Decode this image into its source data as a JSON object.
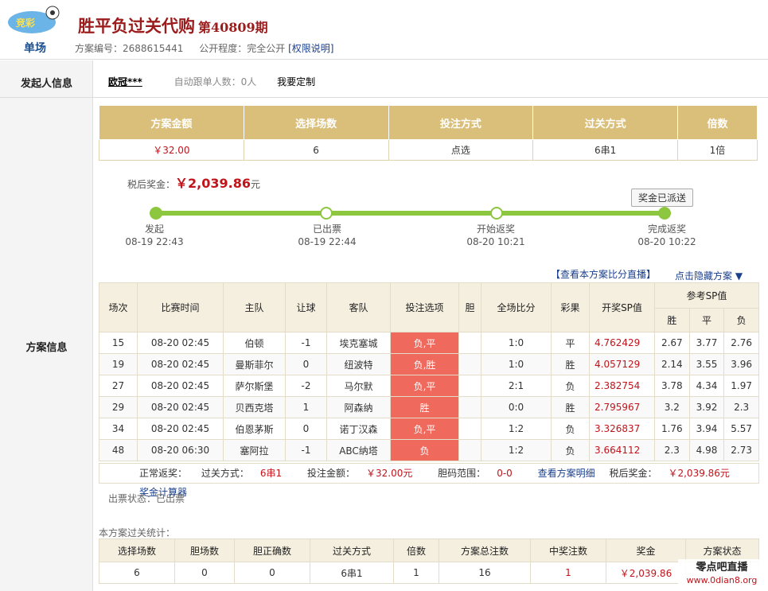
{
  "header": {
    "logo_text": "单场",
    "title": "胜平负过关代购",
    "period": "第40809期",
    "plan_no_label": "方案编号：",
    "plan_no": "2688615441",
    "public_label": "公开程度：",
    "public_value": "完全公开",
    "perm_link": "[权限说明]"
  },
  "left_labels": {
    "initiator": "发起人信息",
    "plan": "方案信息"
  },
  "initiator": {
    "name": "欧冠***",
    "follow": "自动跟单人数：0人",
    "custom": "我要定制"
  },
  "summary": {
    "headers": [
      "方案金额",
      "选择场数",
      "投注方式",
      "过关方式",
      "倍数"
    ],
    "values": [
      "￥32.00",
      "6",
      "点选",
      "6串1",
      "1倍"
    ]
  },
  "prize": {
    "label": "税后奖金：",
    "amount": "￥2,039.86",
    "unit": "元"
  },
  "progress": {
    "paid_button": "奖金已派送",
    "steps": [
      {
        "label": "发起",
        "time": "08-19 22:43"
      },
      {
        "label": "已出票",
        "time": "08-19 22:44"
      },
      {
        "label": "开始返奖",
        "time": "08-20 10:21"
      },
      {
        "label": "完成返奖",
        "time": "08-20 10:22"
      }
    ]
  },
  "links": {
    "live": "【查看本方案比分直播】",
    "hide": "点击隐藏方案 ▼"
  },
  "matches": {
    "headers": [
      "场次",
      "比赛时间",
      "主队",
      "让球",
      "客队",
      "投注选项",
      "胆",
      "全场比分",
      "彩果",
      "开奖SP值",
      "参考SP值"
    ],
    "sp_sub": [
      "胜",
      "平",
      "负"
    ],
    "rows": [
      {
        "no": "15",
        "time": "08-20 02:45",
        "home": "伯顿",
        "hcp": "-1",
        "away": "埃克塞城",
        "pick": "负,平",
        "banker": "",
        "score": "1:0",
        "result": "平",
        "sp": "4.762429",
        "w": "2.67",
        "d": "3.77",
        "l": "2.76"
      },
      {
        "no": "19",
        "time": "08-20 02:45",
        "home": "曼斯菲尔",
        "hcp": "0",
        "away": "纽波特",
        "pick": "负,胜",
        "banker": "",
        "score": "1:0",
        "result": "胜",
        "sp": "4.057129",
        "w": "2.14",
        "d": "3.55",
        "l": "3.96"
      },
      {
        "no": "27",
        "time": "08-20 02:45",
        "home": "萨尔斯堡",
        "hcp": "-2",
        "away": "马尔默",
        "pick": "负,平",
        "banker": "",
        "score": "2:1",
        "result": "负",
        "sp": "2.382754",
        "w": "3.78",
        "d": "4.34",
        "l": "1.97"
      },
      {
        "no": "29",
        "time": "08-20 02:45",
        "home": "贝西克塔",
        "hcp": "1",
        "away": "阿森纳",
        "pick": "胜",
        "banker": "",
        "score": "0:0",
        "result": "胜",
        "sp": "2.795967",
        "w": "3.2",
        "d": "3.92",
        "l": "2.3"
      },
      {
        "no": "34",
        "time": "08-20 02:45",
        "home": "伯恩茅斯",
        "hcp": "0",
        "away": "诺丁汉森",
        "pick": "负,平",
        "banker": "",
        "score": "1:2",
        "result": "负",
        "sp": "3.326837",
        "w": "1.76",
        "d": "3.94",
        "l": "5.57"
      },
      {
        "no": "48",
        "time": "08-20 06:30",
        "home": "塞阿拉",
        "hcp": "-1",
        "away": "ABC纳塔",
        "pick": "负",
        "banker": "",
        "score": "1:2",
        "result": "负",
        "sp": "3.664112",
        "w": "2.3",
        "d": "4.98",
        "l": "2.73"
      }
    ],
    "footer": {
      "return_label": "正常返奖：",
      "pass_label": "过关方式：",
      "pass_value": "6串1",
      "amount_label": "投注金额：",
      "amount_value": "￥32.00元",
      "banker_label": "胆码范围：",
      "banker_value": "0-0",
      "detail_link": "查看方案明细",
      "tax_label": "税后奖金：",
      "tax_value": "￥2,039.86元",
      "calc_link": "奖金计算器"
    }
  },
  "ticket_status": "出票状态：已出票",
  "stats": {
    "title": "本方案过关统计：",
    "headers": [
      "选择场数",
      "胆场数",
      "胆正确数",
      "过关方式",
      "倍数",
      "方案总注数",
      "中奖注数",
      "奖金",
      "方案状态"
    ],
    "values": [
      "6",
      "0",
      "0",
      "6串1",
      "1",
      "16",
      "1",
      "￥2,039.86",
      ""
    ]
  },
  "watermark": {
    "line1": "零点吧直播",
    "line2": "www.0dian8.org"
  },
  "colors": {
    "accent": "#d9bf7a",
    "red": "#c0141b",
    "progress": "#8dc63f",
    "pick": "#f0695d"
  }
}
